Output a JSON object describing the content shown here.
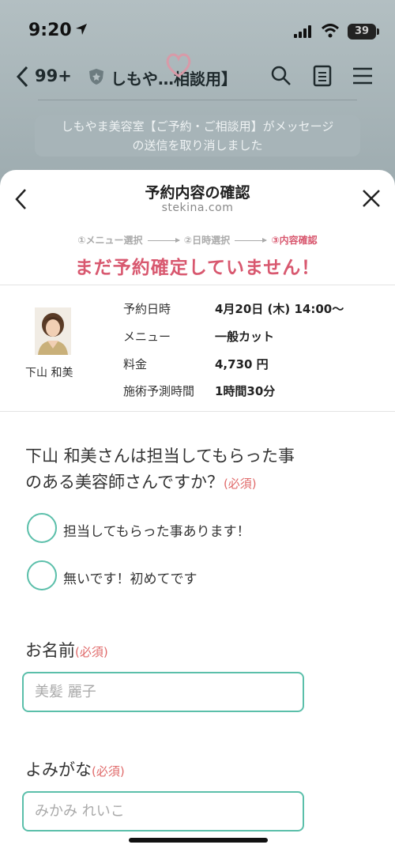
{
  "status_bar": {
    "time": "9:20",
    "battery": "39"
  },
  "chat_header": {
    "back_count": "99+",
    "title": "しもや…相談用】"
  },
  "notice": {
    "line1": "しもやま美容室【ご予約・ご相談用】がメッセージ",
    "line2": "の送信を取り消しました"
  },
  "sheet": {
    "title": "予約内容の確認",
    "domain": "stekina.com"
  },
  "steps": {
    "step1": "①メニュー選択",
    "step2": "②日時選択",
    "step3": "③内容確認"
  },
  "warning": "まだ予約確定していません！",
  "booking": {
    "staff_name": "下山 和美",
    "rows": [
      {
        "label": "予約日時",
        "value": "4月20日 (木) 14:00〜"
      },
      {
        "label": "メニュー",
        "value": "一般カット"
      },
      {
        "label": "料金",
        "value": "4,730 円"
      },
      {
        "label": "施術予測時間",
        "value": "1時間30分"
      }
    ]
  },
  "form": {
    "question_line1": "下山 和美さんは担当してもらった事",
    "question_line2": "のある美容師さんですか？",
    "required": "(必須)",
    "options": [
      "担当してもらった事あります！",
      "無いです！初めてです"
    ],
    "name_label": "お名前",
    "name_placeholder": "美髪 麗子",
    "kana_label": "よみがな",
    "kana_placeholder": "みかみ れいこ"
  },
  "colors": {
    "accent_pink": "#d8586f",
    "accent_teal": "#5bbfaa",
    "required_red": "#e06a6a"
  }
}
